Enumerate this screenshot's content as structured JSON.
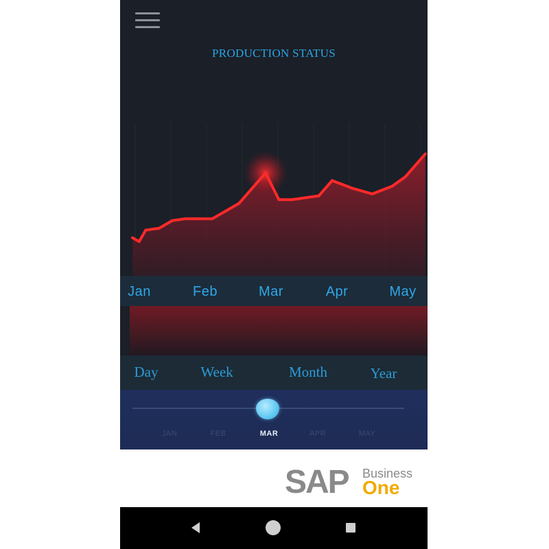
{
  "header": {
    "title": "PRODUCTION STATUS",
    "menu_icon": "hamburger-menu-icon"
  },
  "chart_data": {
    "type": "area",
    "categories": [
      "Jan",
      "Feb",
      "Mar",
      "Apr",
      "May"
    ],
    "x": [
      0,
      0.1,
      0.2,
      0.4,
      0.6,
      0.8,
      1.0,
      1.2,
      1.4,
      1.6,
      1.8,
      2.0,
      2.2,
      2.4,
      2.6,
      2.8,
      3.0,
      3.3,
      3.6,
      3.9,
      4.1,
      4.4
    ],
    "values": [
      1.0,
      0.9,
      1.2,
      1.25,
      1.45,
      1.5,
      1.5,
      1.5,
      1.7,
      1.9,
      2.3,
      2.7,
      2.0,
      2.0,
      2.05,
      2.1,
      2.5,
      2.3,
      2.15,
      2.35,
      2.6,
      3.2
    ],
    "highlight_category": "Mar",
    "line_color": "#ff2a2a",
    "fill_color": "#8a1d28"
  },
  "period_selector": {
    "options": [
      "Day",
      "Week",
      "Month",
      "Year"
    ],
    "color": "#2d9bd6"
  },
  "month_slider": {
    "months": [
      "JAN",
      "FEB",
      "MAR",
      "APR",
      "MAY"
    ],
    "selected": "MAR",
    "thumb_icon": "slider-thumb-icon"
  },
  "footer": {
    "logo_sap": "SAP",
    "logo_business": "Business",
    "logo_one": "One"
  },
  "nav": {
    "back_icon": "back-triangle-icon",
    "home_icon": "home-circle-icon",
    "recent_icon": "recent-apps-square-icon"
  },
  "colors": {
    "background": "#1b1f27",
    "accent_blue": "#27a6e6",
    "sap_gray": "#8a8a8a",
    "sap_gold": "#f0ab00"
  }
}
